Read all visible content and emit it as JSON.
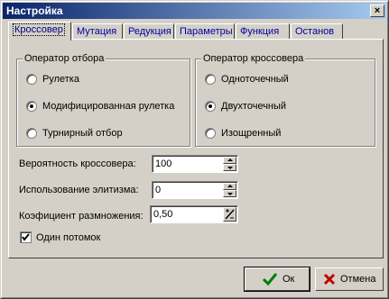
{
  "window": {
    "title": "Настройка",
    "close_label": "×"
  },
  "tabs": [
    {
      "label": "Кроссовер",
      "active": true
    },
    {
      "label": "Мутация"
    },
    {
      "label": "Редукция"
    },
    {
      "label": "Параметры"
    },
    {
      "label": "Функция"
    },
    {
      "label": "Останов"
    }
  ],
  "selection_group": {
    "title": "Оператор отбора",
    "options": [
      "Рулетка",
      "Модифицированная рулетка",
      "Турнирный отбор"
    ],
    "selected_index": 1
  },
  "crossover_group": {
    "title": "Оператор кроссовера",
    "options": [
      "Одноточечный",
      "Двухточечный",
      "Изощренный"
    ],
    "selected_index": 1
  },
  "fields": {
    "crossover_probability": {
      "label": "Вероятность кроссовера:",
      "value": "100"
    },
    "elitism": {
      "label": "Использование элитизма:",
      "value": "0"
    },
    "reproduction_coefficient": {
      "label": "Коэфициент размножения:",
      "value": "0,50"
    }
  },
  "single_offspring": {
    "label": "Один потомок",
    "checked": true
  },
  "buttons": {
    "ok_label": "Ок",
    "cancel_label": "Отмена"
  },
  "colors": {
    "title_start": "#0a246a",
    "title_end": "#a6caf0",
    "face": "#d4d0c8",
    "ok_check": "#008000",
    "cancel_x": "#c00000"
  }
}
